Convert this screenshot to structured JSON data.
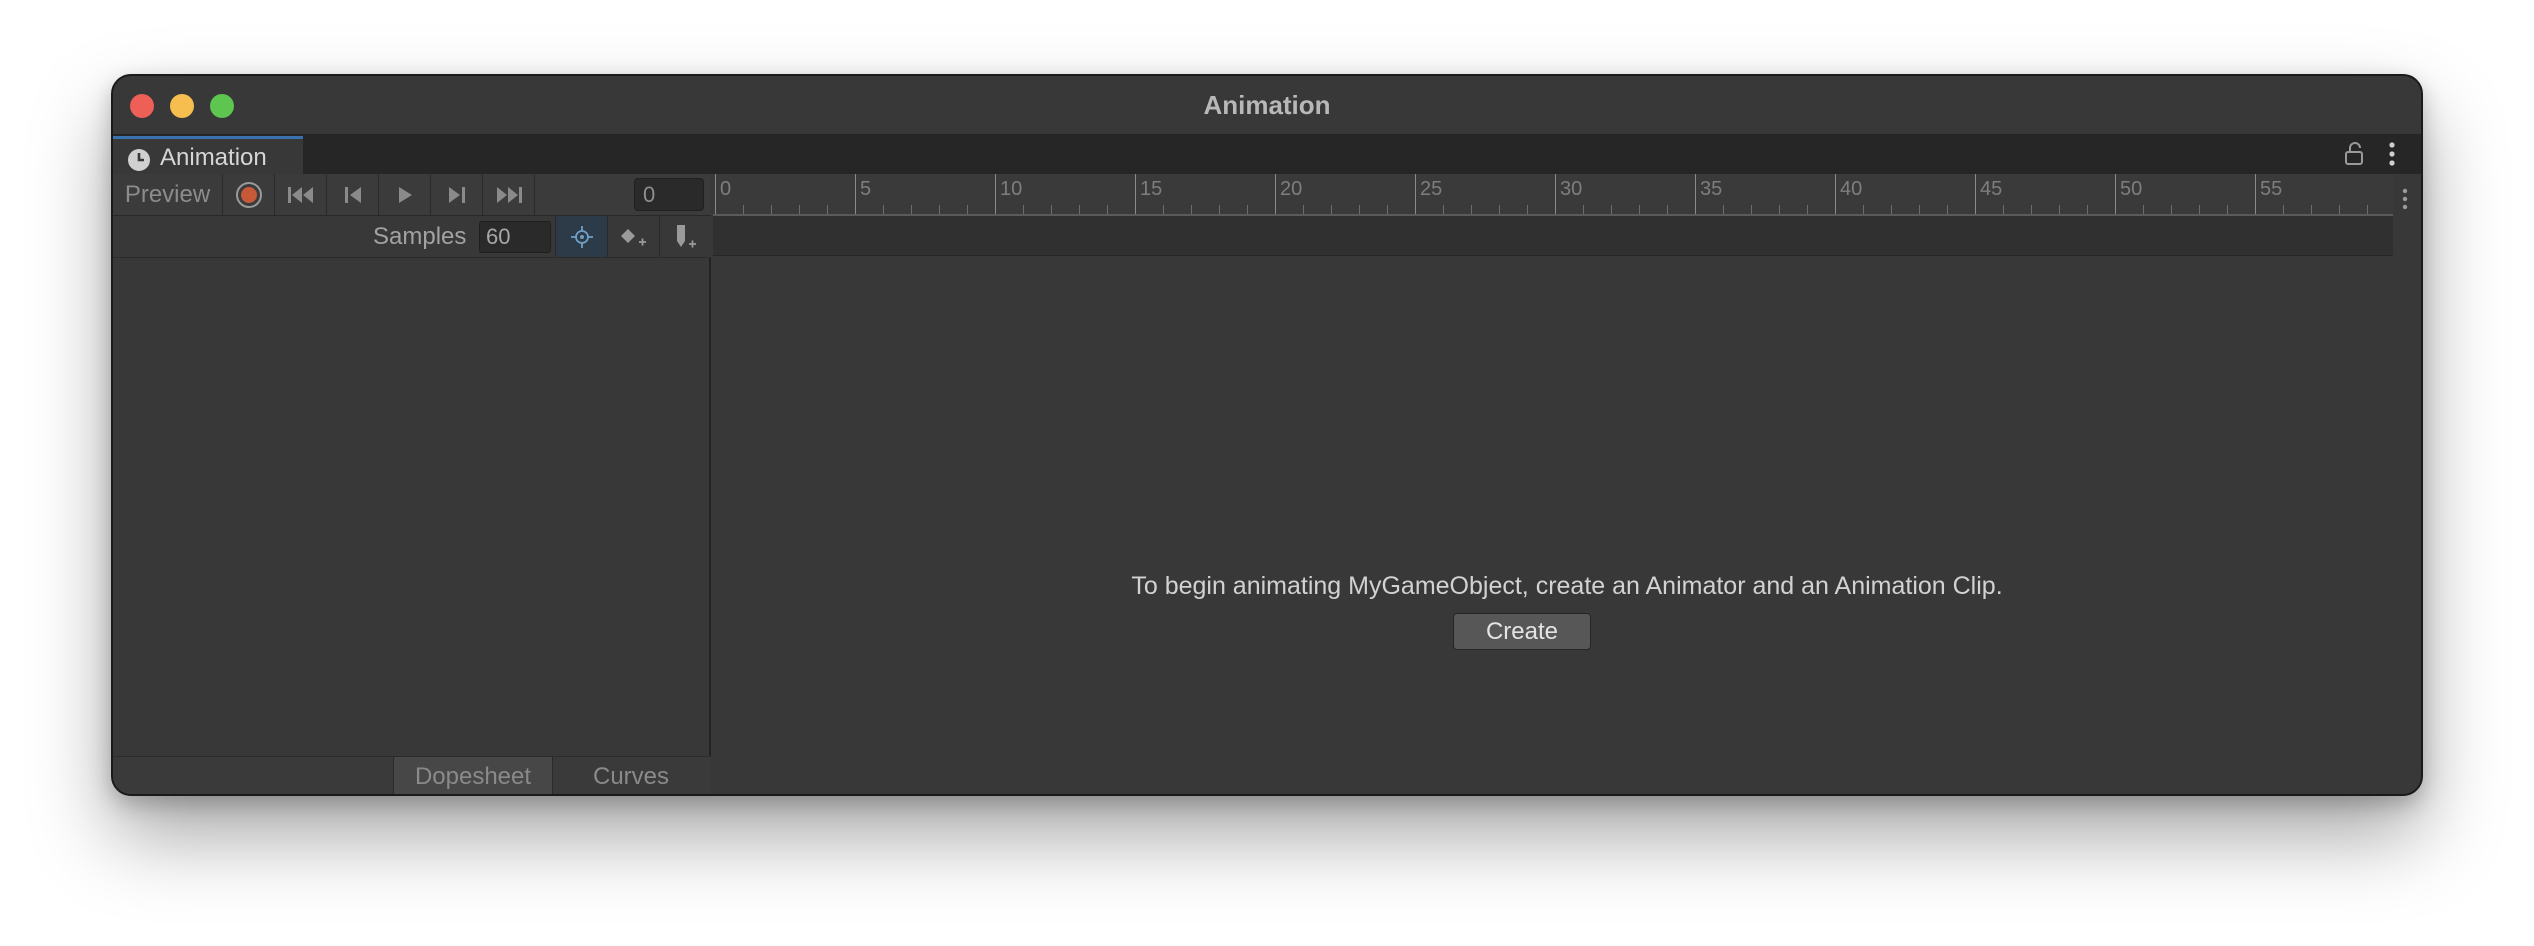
{
  "window": {
    "title": "Animation"
  },
  "tab": {
    "label": "Animation",
    "icon": "clock-icon"
  },
  "toolbar": {
    "preview_label": "Preview",
    "frame_value": "0",
    "record_color": "#c65a38"
  },
  "row2": {
    "samples_label": "Samples",
    "samples_value": "60"
  },
  "timeline": {
    "ticks": [
      "0",
      "5",
      "10",
      "15",
      "20",
      "25",
      "30",
      "35",
      "40",
      "45",
      "50",
      "55"
    ]
  },
  "content": {
    "message": "To begin animating MyGameObject, create an Animator and an Animation Clip.",
    "create_label": "Create"
  },
  "bottom_tabs": {
    "dopesheet": "Dopesheet",
    "curves": "Curves"
  }
}
